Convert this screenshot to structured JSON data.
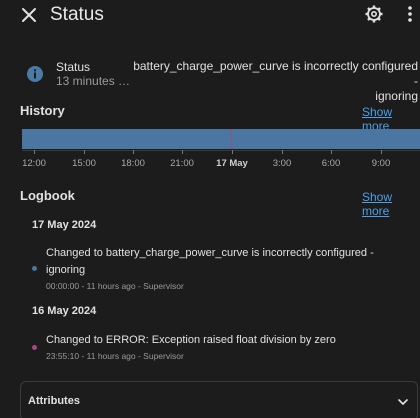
{
  "header": {
    "title": "Status",
    "icons": {
      "close": "close-icon",
      "settings": "gear-icon",
      "more": "more-vertical-icon"
    }
  },
  "status": {
    "icon": "info-icon",
    "name": "Status",
    "time": "13 minutes …",
    "value_line1": "battery_charge_power_curve is incorrectly configured -",
    "value_line2": "ignoring"
  },
  "history": {
    "heading": "History",
    "show_more": "Show more",
    "ticks": [
      "12:00",
      "15:00",
      "18:00",
      "21:00",
      "17 May",
      "3:00",
      "6:00",
      "9:00"
    ],
    "colors": {
      "bar": "#4a76a1",
      "marker": "#a04a8a"
    }
  },
  "logbook": {
    "heading": "Logbook",
    "show_more": "Show more",
    "groups": [
      {
        "date": "17 May 2024",
        "entries": [
          {
            "message_line1": "Changed to battery_charge_power_curve is incorrectly configured -",
            "message_line2": "ignoring",
            "meta": "00:00:00 - 11 hours ago - Supervisor",
            "dot_color": "#4a76a1"
          }
        ]
      },
      {
        "date": "16 May 2024",
        "entries": [
          {
            "message_line1": "Changed to ERROR: Exception raised float division by zero",
            "meta": "23:55:10 - 11 hours ago - Supervisor",
            "dot_color": "#a04a8a"
          }
        ]
      }
    ]
  },
  "attributes": {
    "label": "Attributes",
    "icon": "chevron-down-icon"
  },
  "colors": {
    "background": "#1c1c1c",
    "link": "#4d9fea",
    "text": "#e1e1e1",
    "secondary": "#9b9b9b"
  }
}
